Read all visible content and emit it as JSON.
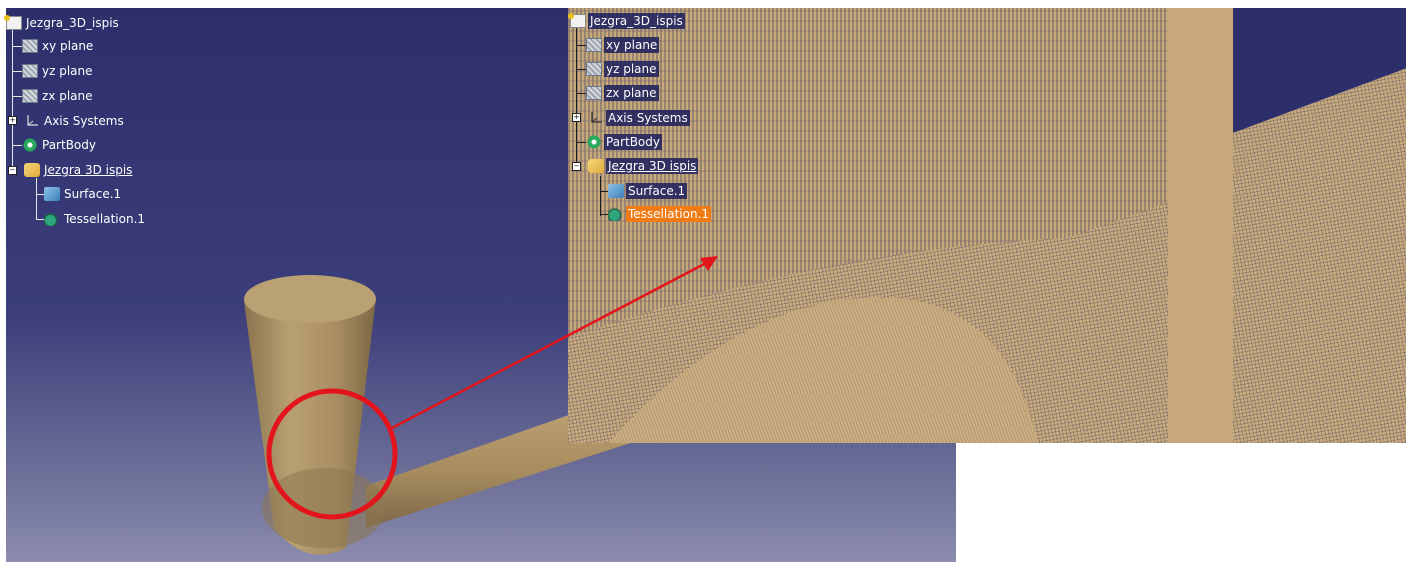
{
  "left_tree": {
    "root": "Jezgra_3D_ispis",
    "items": [
      {
        "label": "xy plane",
        "icon": "plane-icon"
      },
      {
        "label": "yz plane",
        "icon": "plane-icon"
      },
      {
        "label": "zx plane",
        "icon": "plane-icon"
      },
      {
        "label": "Axis Systems",
        "icon": "axis-system-icon"
      },
      {
        "label": "PartBody",
        "icon": "gear-icon"
      },
      {
        "label": "Jezgra 3D ispis",
        "icon": "geometrical-set-icon"
      },
      {
        "label": "Surface.1",
        "icon": "surface-icon"
      },
      {
        "label": "Tessellation.1",
        "icon": "tessellation-icon"
      }
    ]
  },
  "right_tree": {
    "root": "Jezgra_3D_ispis",
    "items": [
      {
        "label": "xy plane",
        "icon": "plane-icon"
      },
      {
        "label": "yz plane",
        "icon": "plane-icon"
      },
      {
        "label": "zx plane",
        "icon": "plane-icon"
      },
      {
        "label": "Axis Systems",
        "icon": "axis-system-icon"
      },
      {
        "label": "PartBody",
        "icon": "gear-icon"
      },
      {
        "label": "Jezgra 3D ispis",
        "icon": "geometrical-set-icon"
      },
      {
        "label": "Surface.1",
        "icon": "surface-icon"
      },
      {
        "label": "Tessellation.1",
        "icon": "tessellation-icon",
        "selected": true
      }
    ]
  },
  "colors": {
    "viewport_top": "#2d2f6c",
    "viewport_bottom": "#8b8cae",
    "model_tan": "#b89d6e",
    "mesh_tan": "#c7a87a",
    "highlight_red": "#e3141b",
    "selection_orange": "#f07b14"
  }
}
